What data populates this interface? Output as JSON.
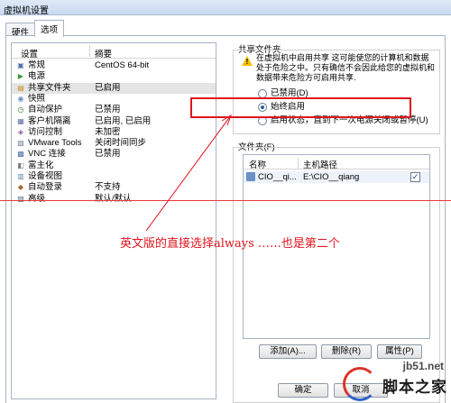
{
  "window": {
    "title": "虚拟机设置"
  },
  "tabs": [
    {
      "label": "硬件"
    },
    {
      "label": "选项"
    }
  ],
  "settings": {
    "headers": {
      "setting": "设置",
      "summary": "摘要"
    },
    "items": [
      {
        "name": "常规",
        "summary": "CentOS 64-bit",
        "icon": "general-icon"
      },
      {
        "name": "电源",
        "summary": "",
        "icon": "power-icon"
      },
      {
        "name": "共享文件夹",
        "summary": "已启用",
        "icon": "shared-folder-icon",
        "selected": true
      },
      {
        "name": "快照",
        "summary": "",
        "icon": "snapshot-icon"
      },
      {
        "name": "自动保护",
        "summary": "已禁用",
        "icon": "autoprotect-icon"
      },
      {
        "name": "客户机隔离",
        "summary": "已启用, 已启用",
        "icon": "isolation-icon"
      },
      {
        "name": "访问控制",
        "summary": "未加密",
        "icon": "access-control-icon"
      },
      {
        "name": "VMware Tools",
        "summary": "关闭时间同步",
        "icon": "vmware-tools-icon"
      },
      {
        "name": "VNC 连接",
        "summary": "已禁用",
        "icon": "vnc-icon"
      },
      {
        "name": "富主化",
        "summary": "",
        "icon": "unity-icon"
      },
      {
        "name": "设备视图",
        "summary": "",
        "icon": "device-view-icon"
      },
      {
        "name": "自动登录",
        "summary": "不支持",
        "icon": "autologin-icon"
      },
      {
        "name": "高级",
        "summary": "默认/默认",
        "icon": "advanced-icon"
      }
    ]
  },
  "shared_folders": {
    "group_title": "共享文件夹",
    "warning": "在虚拟机中启用共享 这可能使您的计算机和数据处于危险之中。只有确信不会因此给您的虚拟机和数据带来危险方可启用共享.",
    "options": [
      {
        "label": "已禁用(D)",
        "checked": false
      },
      {
        "label": "始终启用",
        "checked": true
      },
      {
        "label": "启用状态，直到下一次电源关闭或暂停(U)",
        "checked": false
      }
    ]
  },
  "folders": {
    "group_title": "文件夹(F)",
    "headers": {
      "name": "名称",
      "path": "主机路径"
    },
    "rows": [
      {
        "name": "CIO__qi...",
        "path": "E:\\CIO__qiang",
        "enabled": true
      }
    ],
    "buttons": {
      "add": "添加(A)...",
      "remove": "删除(R)",
      "properties": "属性(P)"
    }
  },
  "dialog_buttons": {
    "ok": "确定",
    "cancel": "取消"
  },
  "annotation": {
    "text": "英文版的直接选择always ……也是第二个",
    "color": "#e0141e"
  },
  "watermark": {
    "site": "jb51.net",
    "name": "脚本之家"
  },
  "colors": {
    "accent_red": "#e0141e",
    "selection_gray": "#e5e5e5",
    "radio_dot": "#2a5fa8"
  }
}
